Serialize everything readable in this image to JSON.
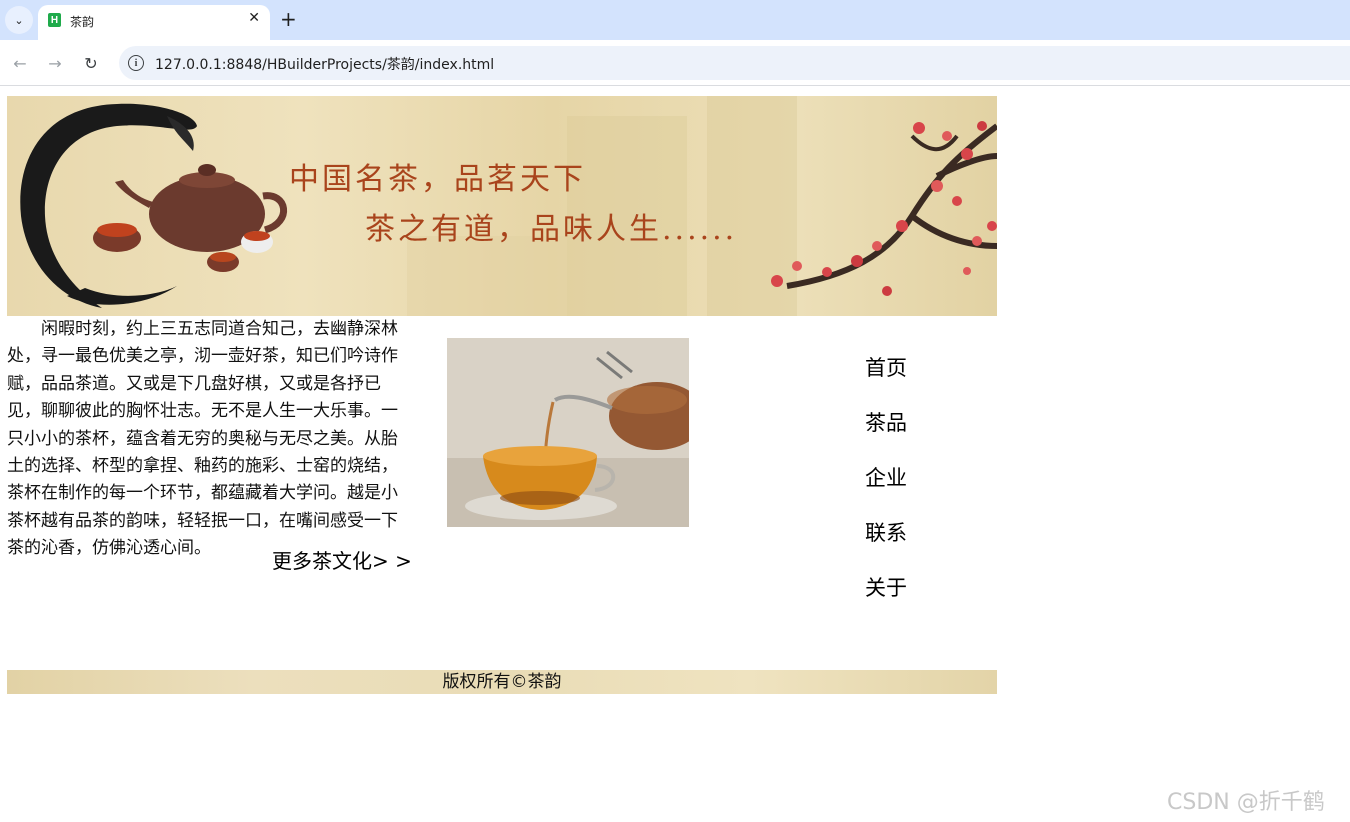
{
  "browser": {
    "tab": {
      "title": "茶韵",
      "favicon_letter": "H",
      "close_glyph": "✕"
    },
    "new_tab_glyph": "+",
    "tab_menu_glyph": "⌄",
    "nav": {
      "back_glyph": "←",
      "forward_glyph": "→",
      "reload_glyph": "↻"
    },
    "address": {
      "url": "127.0.0.1:8848/HBuilderProjects/茶韵/index.html",
      "info_glyph": "i"
    }
  },
  "banner": {
    "slogan_line1": "中国名茶，品茗天下",
    "slogan_line2": "茶之有道，品味人生......"
  },
  "intro": {
    "text": "闲暇时刻，约上三五志同道合知己，去幽静深林处，寻一最色优美之亭，沏一壶好茶，知已们吟诗作赋，品品茶道。又或是下几盘好棋，又或是各抒已见，聊聊彼此的胸怀壮志。无不是人生一大乐事。一只小小的茶杯，蕴含着无穷的奥秘与无尽之美。从胎土的选择、杯型的拿捏、釉药的施彩、士窑的烧结，茶杯在制作的每一个环节，都蕴藏着大学问。越是小茶杯越有品茶的韵味，轻轻抿一口，在嘴间感受一下茶的沁香，仿佛沁透心间。",
    "more_link": "更多茶文化> >"
  },
  "side_nav": {
    "items": [
      {
        "label": "首页"
      },
      {
        "label": "茶品"
      },
      {
        "label": "企业"
      },
      {
        "label": "联系"
      },
      {
        "label": "关于"
      }
    ]
  },
  "footer": {
    "copyright": "版权所有©茶韵"
  },
  "watermark": "CSDN @折千鹤",
  "colors": {
    "tabbar": "#d3e3fd",
    "banner_bg": "#ecdfb8",
    "slogan": "#a9441c",
    "plum_blossom": "#d8454a",
    "footer_bg": "#e9dcb6"
  }
}
